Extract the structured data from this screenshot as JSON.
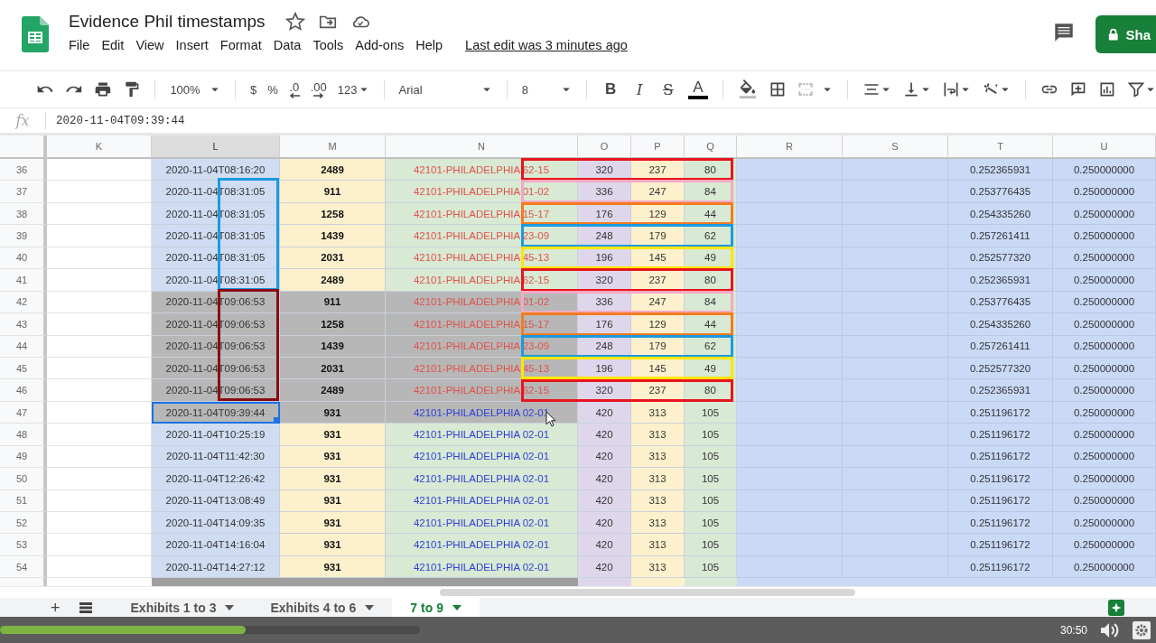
{
  "document": {
    "title": "Evidence Phil timestamps",
    "last_edit": "Last edit was 3 minutes ago",
    "share_label": "Sha"
  },
  "menu": [
    "File",
    "Edit",
    "View",
    "Insert",
    "Format",
    "Data",
    "Tools",
    "Add-ons",
    "Help"
  ],
  "toolbar": {
    "zoom": "100%",
    "currency": "$",
    "percent": "%",
    "decrease_decimals": ".0",
    "increase_decimals": ".00",
    "number_format": "123",
    "font": "Arial",
    "font_size": "8",
    "bold": "B",
    "italic": "I",
    "strikethrough": "S",
    "text_color": "A"
  },
  "formula_bar": {
    "label": "fx",
    "value": "2020-11-04T09:39:44"
  },
  "columns": [
    {
      "label": "K",
      "selected": false
    },
    {
      "label": "L",
      "selected": true
    },
    {
      "label": "M",
      "selected": false
    },
    {
      "label": "N",
      "selected": false
    },
    {
      "label": "O",
      "selected": false
    },
    {
      "label": "P",
      "selected": false
    },
    {
      "label": "Q",
      "selected": false
    },
    {
      "label": "R",
      "selected": false
    },
    {
      "label": "S",
      "selected": false
    },
    {
      "label": "T",
      "selected": false
    },
    {
      "label": "U",
      "selected": false
    }
  ],
  "rows": [
    {
      "number": "36",
      "l": "2020-11-04T08:16:20",
      "m": "2489",
      "n": "42101-PHILADELPHIA 62-15",
      "o": "320",
      "p": "237",
      "q": "80",
      "t": "0.252365931",
      "u": "0.250000000",
      "shaded": false,
      "flagged": true,
      "selected": false,
      "color": "#e8141e"
    },
    {
      "number": "37",
      "l": "2020-11-04T08:31:05",
      "m": "911",
      "n": "42101-PHILADELPHIA 01-02",
      "o": "336",
      "p": "247",
      "q": "84",
      "t": "0.253776435",
      "u": "0.250000000",
      "shaded": false,
      "flagged": true,
      "selected": false,
      "color": "#f5a8c2",
      "l_frame": {
        "color": "#1a9be0"
      }
    },
    {
      "number": "38",
      "l": "2020-11-04T08:31:05",
      "m": "1258",
      "n": "42101-PHILADELPHIA 15-17",
      "o": "176",
      "p": "129",
      "q": "44",
      "t": "0.254335260",
      "u": "0.250000000",
      "shaded": false,
      "flagged": true,
      "selected": false,
      "color": "#f47b20",
      "l_frame": {
        "color": "#1a9be0"
      }
    },
    {
      "number": "39",
      "l": "2020-11-04T08:31:05",
      "m": "1439",
      "n": "42101-PHILADELPHIA 23-09",
      "o": "248",
      "p": "179",
      "q": "62",
      "t": "0.257261411",
      "u": "0.250000000",
      "shaded": false,
      "flagged": true,
      "selected": false,
      "color": "#1a9be0",
      "l_frame": {
        "color": "#1a9be0"
      }
    },
    {
      "number": "40",
      "l": "2020-11-04T08:31:05",
      "m": "2031",
      "n": "42101-PHILADELPHIA 45-13",
      "o": "196",
      "p": "145",
      "q": "49",
      "t": "0.252577320",
      "u": "0.250000000",
      "shaded": false,
      "flagged": true,
      "selected": false,
      "color": "#ffe600",
      "l_frame": {
        "color": "#1a9be0"
      }
    },
    {
      "number": "41",
      "l": "2020-11-04T08:31:05",
      "m": "2489",
      "n": "42101-PHILADELPHIA 62-15",
      "o": "320",
      "p": "237",
      "q": "80",
      "t": "0.252365931",
      "u": "0.250000000",
      "shaded": false,
      "flagged": true,
      "selected": false,
      "color": "#e8141e",
      "l_frame": {
        "color": "#1a9be0"
      }
    },
    {
      "number": "42",
      "l": "2020-11-04T09:06:53",
      "m": "911",
      "n": "42101-PHILADELPHIA 01-02",
      "o": "336",
      "p": "247",
      "q": "84",
      "t": "0.253776435",
      "u": "0.250000000",
      "shaded": true,
      "flagged": true,
      "selected": false,
      "color": "#f5a8c2",
      "l_frame": {
        "color": "#8b0a14"
      }
    },
    {
      "number": "43",
      "l": "2020-11-04T09:06:53",
      "m": "1258",
      "n": "42101-PHILADELPHIA 15-17",
      "o": "176",
      "p": "129",
      "q": "44",
      "t": "0.254335260",
      "u": "0.250000000",
      "shaded": true,
      "flagged": true,
      "selected": false,
      "color": "#f47b20",
      "l_frame": {
        "color": "#8b0a14"
      }
    },
    {
      "number": "44",
      "l": "2020-11-04T09:06:53",
      "m": "1439",
      "n": "42101-PHILADELPHIA 23-09",
      "o": "248",
      "p": "179",
      "q": "62",
      "t": "0.257261411",
      "u": "0.250000000",
      "shaded": true,
      "flagged": true,
      "selected": false,
      "color": "#1a9be0",
      "l_frame": {
        "color": "#8b0a14"
      }
    },
    {
      "number": "45",
      "l": "2020-11-04T09:06:53",
      "m": "2031",
      "n": "42101-PHILADELPHIA 45-13",
      "o": "196",
      "p": "145",
      "q": "49",
      "t": "0.252577320",
      "u": "0.250000000",
      "shaded": true,
      "flagged": true,
      "selected": false,
      "color": "#ffe600",
      "l_frame": {
        "color": "#8b0a14"
      }
    },
    {
      "number": "46",
      "l": "2020-11-04T09:06:53",
      "m": "2489",
      "n": "42101-PHILADELPHIA 62-15",
      "o": "320",
      "p": "237",
      "q": "80",
      "t": "0.252365931",
      "u": "0.250000000",
      "shaded": true,
      "flagged": true,
      "selected": false,
      "color": "#e8141e",
      "l_frame": {
        "color": "#8b0a14"
      }
    },
    {
      "number": "47",
      "l": "2020-11-04T09:39:44",
      "m": "931",
      "n": "42101-PHILADELPHIA 02-01",
      "o": "420",
      "p": "313",
      "q": "105",
      "t": "0.251196172",
      "u": "0.250000000",
      "shaded": true,
      "flagged": false,
      "selected": true
    },
    {
      "number": "48",
      "l": "2020-11-04T10:25:19",
      "m": "931",
      "n": "42101-PHILADELPHIA 02-01",
      "o": "420",
      "p": "313",
      "q": "105",
      "t": "0.251196172",
      "u": "0.250000000",
      "shaded": false,
      "flagged": false,
      "selected": false
    },
    {
      "number": "49",
      "l": "2020-11-04T11:42:30",
      "m": "931",
      "n": "42101-PHILADELPHIA 02-01",
      "o": "420",
      "p": "313",
      "q": "105",
      "t": "0.251196172",
      "u": "0.250000000",
      "shaded": false,
      "flagged": false,
      "selected": false
    },
    {
      "number": "50",
      "l": "2020-11-04T12:26:42",
      "m": "931",
      "n": "42101-PHILADELPHIA 02-01",
      "o": "420",
      "p": "313",
      "q": "105",
      "t": "0.251196172",
      "u": "0.250000000",
      "shaded": false,
      "flagged": false,
      "selected": false
    },
    {
      "number": "51",
      "l": "2020-11-04T13:08:49",
      "m": "931",
      "n": "42101-PHILADELPHIA 02-01",
      "o": "420",
      "p": "313",
      "q": "105",
      "t": "0.251196172",
      "u": "0.250000000",
      "shaded": false,
      "flagged": false,
      "selected": false
    },
    {
      "number": "52",
      "l": "2020-11-04T14:09:35",
      "m": "931",
      "n": "42101-PHILADELPHIA 02-01",
      "o": "420",
      "p": "313",
      "q": "105",
      "t": "0.251196172",
      "u": "0.250000000",
      "shaded": false,
      "flagged": false,
      "selected": false
    },
    {
      "number": "53",
      "l": "2020-11-04T14:16:04",
      "m": "931",
      "n": "42101-PHILADELPHIA 02-01",
      "o": "420",
      "p": "313",
      "q": "105",
      "t": "0.251196172",
      "u": "0.250000000",
      "shaded": false,
      "flagged": false,
      "selected": false
    },
    {
      "number": "54",
      "l": "2020-11-04T14:27:12",
      "m": "931",
      "n": "42101-PHILADELPHIA 02-01",
      "o": "420",
      "p": "313",
      "q": "105",
      "t": "0.251196172",
      "u": "0.250000000",
      "shaded": false,
      "flagged": false,
      "selected": false
    }
  ],
  "sheet_tabs": {
    "add": "+",
    "tabs": [
      {
        "label": "Exhibits 1 to 3",
        "selected": false
      },
      {
        "label": "Exhibits 4 to 6",
        "selected": false
      },
      {
        "label": "7 to 9",
        "selected": true
      }
    ]
  },
  "player": {
    "level": 0.585,
    "time": "30:50"
  }
}
